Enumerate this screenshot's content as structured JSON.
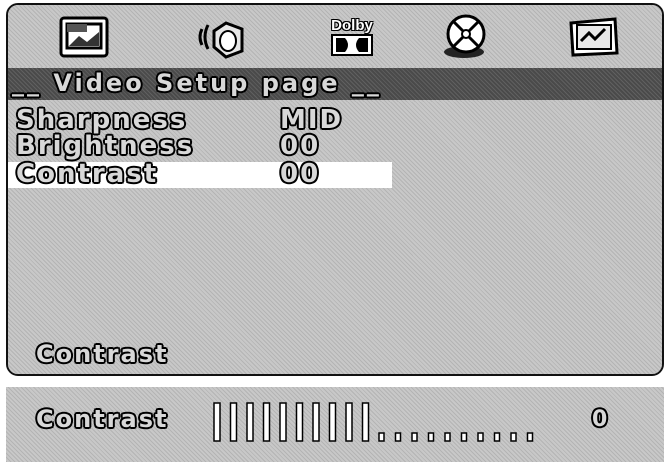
{
  "title": "__ Video Setup page __",
  "icons": [
    "tv-picture-icon",
    "speaker-audio-icon",
    "dolby-icon",
    "disc-icon",
    "preference-icon"
  ],
  "dolby_label": "Dolby",
  "rows": [
    {
      "label": "Sharpness",
      "value": "MID",
      "selected": false
    },
    {
      "label": "Brightness",
      "value": "00",
      "selected": false
    },
    {
      "label": "Contrast",
      "value": "00",
      "selected": true
    }
  ],
  "help_text": "Contrast",
  "slider": {
    "label": "Contrast",
    "value": "0",
    "filled_fraction": 0.5,
    "total_ticks": 20
  }
}
